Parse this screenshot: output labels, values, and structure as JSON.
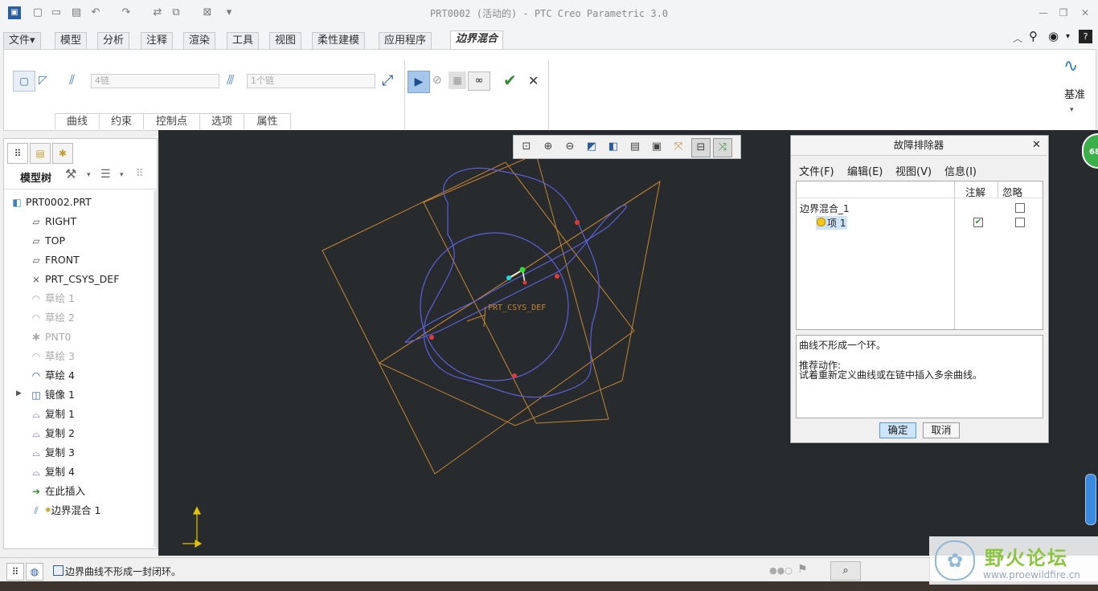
{
  "window": {
    "title": "PRT0002 (活动的) - PTC Creo Parametric 3.0"
  },
  "tabs": [
    {
      "label": "文件▾"
    },
    {
      "label": "模型"
    },
    {
      "label": "分析"
    },
    {
      "label": "注释"
    },
    {
      "label": "渲染"
    },
    {
      "label": "工具"
    },
    {
      "label": "视图"
    },
    {
      "label": "柔性建模"
    },
    {
      "label": "应用程序"
    },
    {
      "label": "边界混合"
    }
  ],
  "ribbon": {
    "first_direction_value": "4链",
    "second_direction_value": "1个链",
    "groups": [
      "曲线",
      "约束",
      "控制点",
      "选项",
      "属性"
    ],
    "datum_label": "基准"
  },
  "left_panel": {
    "model_tree_label": "模型树",
    "items": [
      {
        "label": "PRT0002.PRT",
        "icon": "part-icon",
        "dim": false
      },
      {
        "label": "RIGHT",
        "icon": "datum-plane-icon",
        "dim": false
      },
      {
        "label": "TOP",
        "icon": "datum-plane-icon",
        "dim": false
      },
      {
        "label": "FRONT",
        "icon": "datum-plane-icon",
        "dim": false
      },
      {
        "label": "PRT_CSYS_DEF",
        "icon": "csys-icon",
        "dim": false
      },
      {
        "label": "草绘 1",
        "icon": "sketch-icon",
        "dim": true
      },
      {
        "label": "草绘 2",
        "icon": "sketch-icon",
        "dim": true
      },
      {
        "label": "PNT0",
        "icon": "datum-point-icon",
        "dim": true
      },
      {
        "label": "草绘 3",
        "icon": "sketch-icon",
        "dim": true
      },
      {
        "label": "草绘 4",
        "icon": "sketch-icon",
        "dim": false
      },
      {
        "label": "镜像 1",
        "icon": "mirror-icon",
        "dim": false
      },
      {
        "label": "复制 1",
        "icon": "copy-icon",
        "dim": false
      },
      {
        "label": "复制 2",
        "icon": "copy-icon",
        "dim": false
      },
      {
        "label": "复制 3",
        "icon": "copy-icon",
        "dim": false
      },
      {
        "label": "复制 4",
        "icon": "copy-icon",
        "dim": false
      },
      {
        "label": "在此插入",
        "icon": "insert-here-icon",
        "dim": false
      },
      {
        "label": "边界混合 1",
        "icon": "boundary-blend-icon",
        "dim": false
      }
    ]
  },
  "graphics": {
    "csys_label": "PRT_CSYS_DEF",
    "side_badge": "68"
  },
  "dialog": {
    "title": "故障排除器",
    "menu": [
      "文件(F)",
      "编辑(E)",
      "视图(V)",
      "信息(I)"
    ],
    "col_note": "注解",
    "col_ignore": "忽略",
    "row_parent": "边界混合_1",
    "row_child": "项 1",
    "message": "曲线不形成一个环。",
    "recommend_title": "推荐动作:",
    "recommend_text": "试着重新定义曲线或在链中插入多余曲线。",
    "ok": "确定",
    "cancel": "取消"
  },
  "status": {
    "message": "边界曲线不形成一封闭环。"
  },
  "watermark": {
    "title": "野火论坛",
    "url": "www.proewildfire.cn"
  },
  "colors": {
    "accent": "#5a9bd5",
    "graphics_bg": "#272b2e",
    "datum": "#c8842f",
    "curve": "#5b5fdc",
    "check": "#2e8b2e"
  }
}
